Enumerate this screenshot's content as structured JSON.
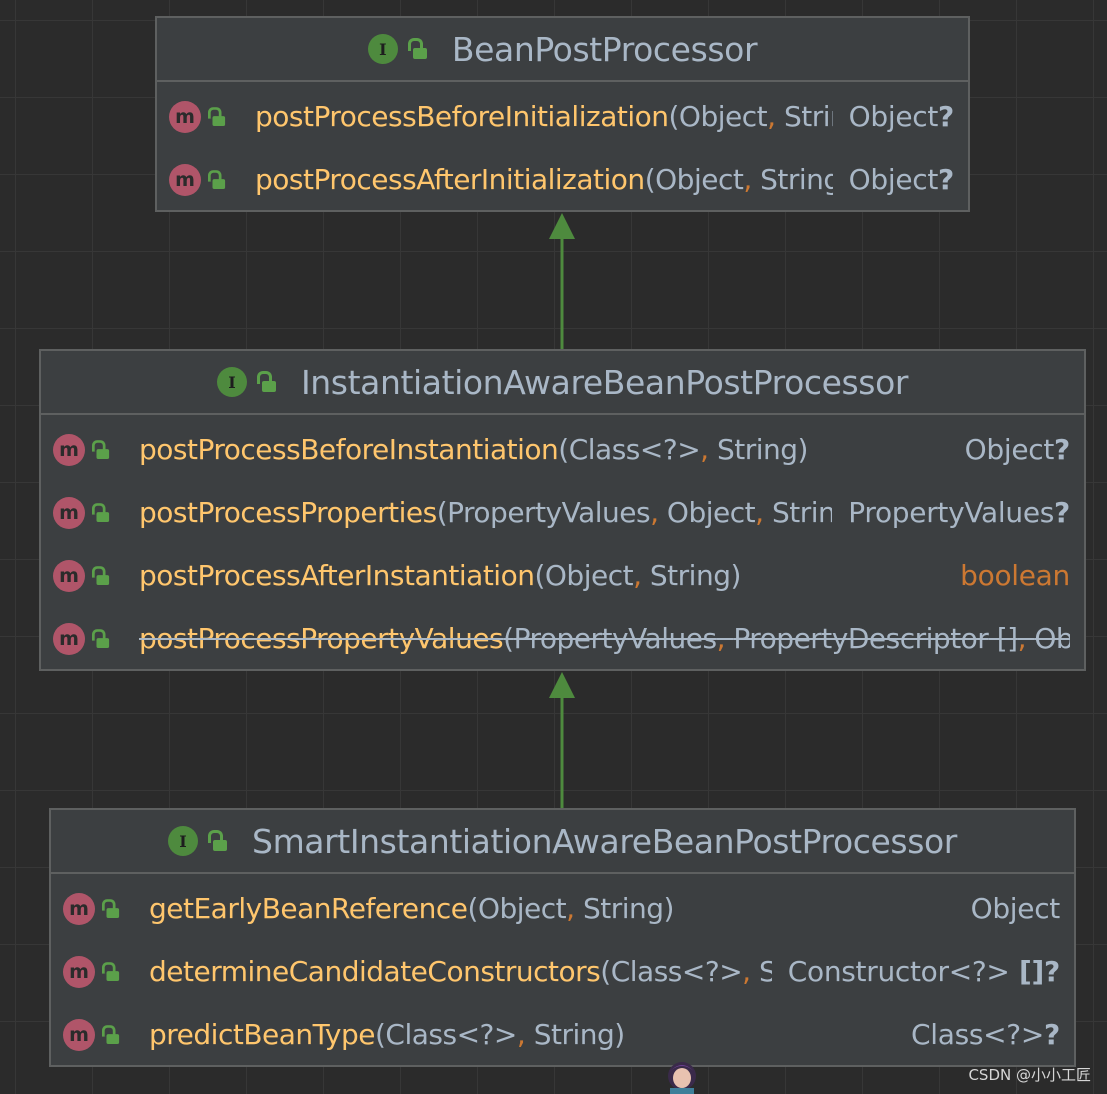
{
  "watermark": "CSDN @小小工匠",
  "nodes": [
    {
      "title": "BeanPostProcessor",
      "icon": "interface-icon",
      "methods": [
        {
          "name": "postProcessBeforeInitialization",
          "params": [
            {
              "t": "Object"
            },
            {
              "t": "String"
            }
          ],
          "ret": "Object",
          "nullable": true,
          "deprecated": false,
          "keyword": false
        },
        {
          "name": "postProcessAfterInitialization",
          "params": [
            {
              "t": "Object"
            },
            {
              "t": "String"
            }
          ],
          "ret": "Object",
          "nullable": true,
          "deprecated": false,
          "keyword": false
        }
      ]
    },
    {
      "title": "InstantiationAwareBeanPostProcessor",
      "icon": "interface-icon",
      "methods": [
        {
          "name": "postProcessBeforeInstantiation",
          "params": [
            {
              "t": "Class<?>"
            },
            {
              "t": "String"
            }
          ],
          "ret": "Object",
          "nullable": true,
          "deprecated": false,
          "keyword": false
        },
        {
          "name": "postProcessProperties",
          "params": [
            {
              "t": "PropertyValues"
            },
            {
              "t": "Object"
            },
            {
              "t": "String"
            }
          ],
          "ret": "PropertyValues",
          "nullable": true,
          "deprecated": false,
          "keyword": false
        },
        {
          "name": "postProcessAfterInstantiation",
          "params": [
            {
              "t": "Object"
            },
            {
              "t": "String"
            }
          ],
          "ret": "boolean",
          "nullable": false,
          "deprecated": false,
          "keyword": true
        },
        {
          "name": "postProcessPropertyValues",
          "params": [
            {
              "t": "PropertyValues"
            },
            {
              "t": "PropertyDescriptor",
              "array": true
            },
            {
              "t": "Object"
            },
            {
              "t": ""
            }
          ],
          "ret": "",
          "nullable": false,
          "deprecated": true,
          "keyword": false,
          "truncated": true
        }
      ]
    },
    {
      "title": "SmartInstantiationAwareBeanPostProcessor",
      "icon": "interface-icon",
      "methods": [
        {
          "name": "getEarlyBeanReference",
          "params": [
            {
              "t": "Object"
            },
            {
              "t": "String"
            }
          ],
          "ret": "Object",
          "nullable": false,
          "deprecated": false,
          "keyword": false
        },
        {
          "name": "determineCandidateConstructors",
          "params": [
            {
              "t": "Class<?>"
            },
            {
              "t": "String"
            }
          ],
          "ret": "Constructor<?>",
          "retArray": true,
          "nullable": true,
          "deprecated": false,
          "keyword": false
        },
        {
          "name": "predictBeanType",
          "params": [
            {
              "t": "Class<?>"
            },
            {
              "t": "String"
            }
          ],
          "ret": "Class<?>",
          "nullable": true,
          "deprecated": false,
          "keyword": false
        }
      ]
    }
  ],
  "edges": [
    {
      "from": "InstantiationAwareBeanPostProcessor",
      "to": "BeanPostProcessor",
      "kind": "extends"
    },
    {
      "from": "SmartInstantiationAwareBeanPostProcessor",
      "to": "InstantiationAwareBeanPostProcessor",
      "kind": "extends"
    }
  ],
  "colors": {
    "background": "#2b2b2b",
    "node_fill": "#3c3f41",
    "method_name": "#ffc66d",
    "text": "#a9b7c6",
    "keyword": "#cc7832",
    "arrow": "#4e8a3e"
  }
}
